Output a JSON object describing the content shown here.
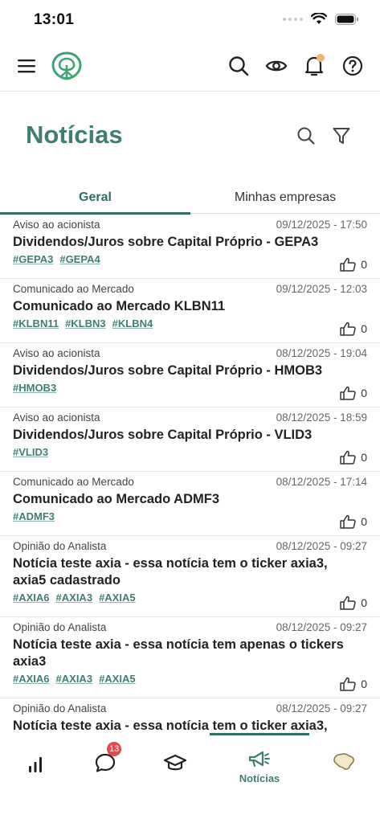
{
  "status_bar": {
    "time": "13:01"
  },
  "header": {
    "menu_icon": "hamburger-menu-icon",
    "logo_icon": "tree-shield-logo-icon",
    "notification_dot_color": "#f0b47a"
  },
  "page": {
    "title": "Notícias"
  },
  "tabs": [
    {
      "label": "Geral",
      "active": true
    },
    {
      "label": "Minhas empresas",
      "active": false
    }
  ],
  "news": [
    {
      "category": "Aviso ao acionista",
      "date": "09/12/2025 - 17:50",
      "title": "Dividendos/Juros sobre Capital Próprio - GEPA3",
      "tags": [
        "#GEPA3",
        "#GEPA4"
      ],
      "likes": "0"
    },
    {
      "category": "Comunicado ao Mercado",
      "date": "09/12/2025 - 12:03",
      "title": "Comunicado ao Mercado KLBN11",
      "tags": [
        "#KLBN11",
        "#KLBN3",
        "#KLBN4"
      ],
      "likes": "0"
    },
    {
      "category": "Aviso ao acionista",
      "date": "08/12/2025 - 19:04",
      "title": "Dividendos/Juros sobre Capital Próprio - HMOB3",
      "tags": [
        "#HMOB3"
      ],
      "likes": "0"
    },
    {
      "category": "Aviso ao acionista",
      "date": "08/12/2025 - 18:59",
      "title": "Dividendos/Juros sobre Capital Próprio - VLID3",
      "tags": [
        "#VLID3"
      ],
      "likes": "0"
    },
    {
      "category": "Comunicado ao Mercado",
      "date": "08/12/2025 - 17:14",
      "title": "Comunicado ao Mercado ADMF3",
      "tags": [
        "#ADMF3"
      ],
      "likes": "0"
    },
    {
      "category": "Opinião do Analista",
      "date": "08/12/2025 - 09:27",
      "title": "Notícia teste axia - essa notícia tem o ticker axia3, axia5 cadastrado",
      "tags": [
        "#AXIA6",
        "#AXIA3",
        "#AXIA5"
      ],
      "likes": "0"
    },
    {
      "category": "Opinião do Analista",
      "date": "08/12/2025 - 09:27",
      "title": "Notícia teste axia - essa notícia tem apenas o tickers axia3",
      "tags": [
        "#AXIA6",
        "#AXIA3",
        "#AXIA5"
      ],
      "likes": "0"
    },
    {
      "category": "Opinião do Analista",
      "date": "08/12/2025 - 09:27",
      "title": "Notícia teste axia - essa notícia tem o ticker axia3,",
      "tags": [],
      "likes": ""
    }
  ],
  "bottom_nav": {
    "chat_badge": "13",
    "active_label": "Notícias",
    "accent_color": "#3f7e73"
  }
}
